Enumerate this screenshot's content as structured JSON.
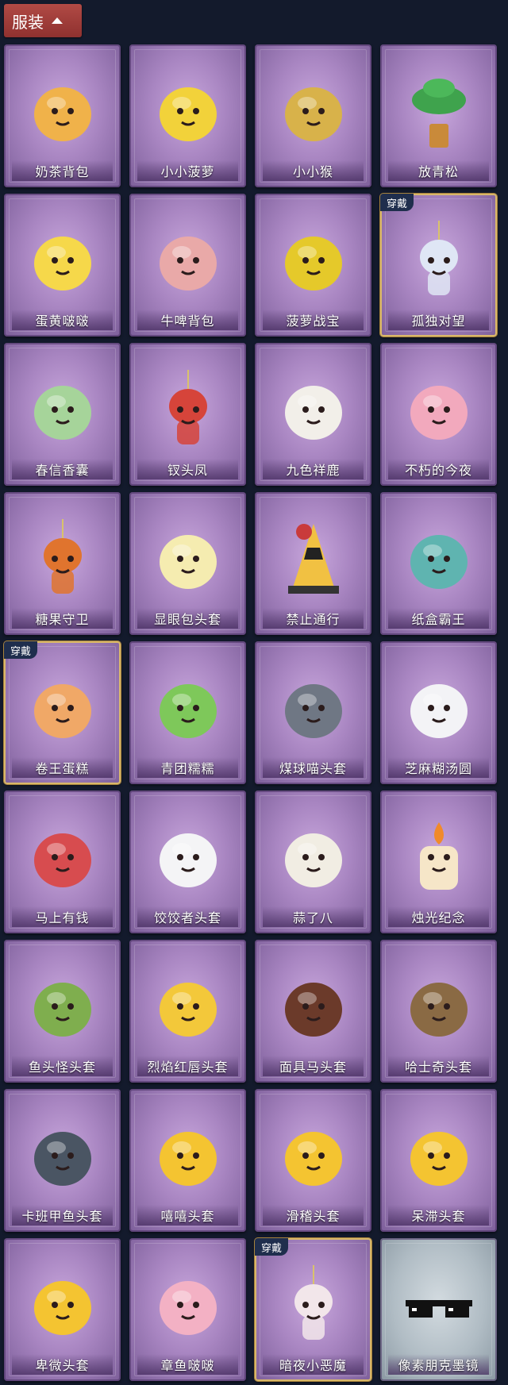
{
  "header": {
    "title": "服装"
  },
  "badge_text": "穿戴",
  "items": [
    {
      "label": "奶茶背包",
      "icon": "milk-tea-backpack-icon",
      "color": "#f0b24a",
      "equipped": false
    },
    {
      "label": "小小菠萝",
      "icon": "pineapple-icon",
      "color": "#f2d23a",
      "equipped": false
    },
    {
      "label": "小小猴",
      "icon": "monkey-icon",
      "color": "#d8b24a",
      "equipped": false
    },
    {
      "label": "放青松",
      "icon": "pine-tree-icon",
      "color": "#3fa34d",
      "equipped": false
    },
    {
      "label": "蛋黄啵啵",
      "icon": "chick-icon",
      "color": "#f6d84a",
      "equipped": false
    },
    {
      "label": "牛啤背包",
      "icon": "cow-beer-icon",
      "color": "#e9a9a8",
      "equipped": false
    },
    {
      "label": "菠萝战宝",
      "icon": "pineapple-robot-icon",
      "color": "#e5c92a",
      "equipped": false
    },
    {
      "label": "孤独对望",
      "icon": "doll-pendant-icon",
      "color": "#dfe6f5",
      "equipped": true
    },
    {
      "label": "春信香囊",
      "icon": "sachet-icon",
      "color": "#a6d49a",
      "equipped": false
    },
    {
      "label": "钗头凤",
      "icon": "phoenix-hairpin-icon",
      "color": "#d6443a",
      "equipped": false
    },
    {
      "label": "九色祥鹿",
      "icon": "deer-icon",
      "color": "#f2efe9",
      "equipped": false
    },
    {
      "label": "不朽的今夜",
      "icon": "pink-cat-bowl-icon",
      "color": "#f2a9bd",
      "equipped": false
    },
    {
      "label": "糖果守卫",
      "icon": "pumpkin-scarecrow-icon",
      "color": "#e0742e",
      "equipped": false
    },
    {
      "label": "显眼包头套",
      "icon": "light-bulb-icon",
      "color": "#f5ecb0",
      "equipped": false
    },
    {
      "label": "禁止通行",
      "icon": "traffic-cone-icon",
      "color": "#f1c142",
      "equipped": false
    },
    {
      "label": "纸盒霸王",
      "icon": "box-dinosaur-icon",
      "color": "#5fb4b0",
      "equipped": false
    },
    {
      "label": "卷王蛋糕",
      "icon": "roll-cake-icon",
      "color": "#f0a867",
      "equipped": true
    },
    {
      "label": "青团糯糯",
      "icon": "green-dumpling-icon",
      "color": "#7ec85a",
      "equipped": false
    },
    {
      "label": "煤球喵头套",
      "icon": "grey-cat-icon",
      "color": "#6f7784",
      "equipped": false
    },
    {
      "label": "芝麻糊汤圆",
      "icon": "rice-ball-icon",
      "color": "#f3f3f6",
      "equipped": false
    },
    {
      "label": "马上有钱",
      "icon": "red-horse-icon",
      "color": "#d74c4f",
      "equipped": false
    },
    {
      "label": "饺饺者头套",
      "icon": "dumpling-icon",
      "color": "#f4f4f6",
      "equipped": false
    },
    {
      "label": "蒜了八",
      "icon": "garlic-icon",
      "color": "#f1ede3",
      "equipped": false
    },
    {
      "label": "烛光纪念",
      "icon": "candle-icon",
      "color": "#f6e6c8",
      "equipped": false
    },
    {
      "label": "鱼头怪头套",
      "icon": "fish-head-icon",
      "color": "#7fae4e",
      "equipped": false
    },
    {
      "label": "烈焰红唇头套",
      "icon": "pikachu-lips-icon",
      "color": "#f3c83a",
      "equipped": false
    },
    {
      "label": "面具马头套",
      "icon": "horse-mask-icon",
      "color": "#6b3a2a",
      "equipped": false
    },
    {
      "label": "哈士奇头套",
      "icon": "husky-icon",
      "color": "#8a6a44",
      "equipped": false
    },
    {
      "label": "卡班甲鱼头套",
      "icon": "turtle-icon",
      "color": "#4a5563",
      "equipped": false
    },
    {
      "label": "嘻嘻头套",
      "icon": "grin-emoji-icon",
      "color": "#f4c431",
      "equipped": false
    },
    {
      "label": "滑稽头套",
      "icon": "smirk-emoji-icon",
      "color": "#f4c431",
      "equipped": false
    },
    {
      "label": "呆滞头套",
      "icon": "dazed-emoji-icon",
      "color": "#f4c431",
      "equipped": false
    },
    {
      "label": "卑微头套",
      "icon": "humble-emoji-icon",
      "color": "#f4c431",
      "equipped": false
    },
    {
      "label": "章鱼啵啵",
      "icon": "octopus-icon",
      "color": "#f3b1c4",
      "equipped": false
    },
    {
      "label": "暗夜小恶魔",
      "icon": "little-devil-icon",
      "color": "#f2e6ea",
      "equipped": true
    },
    {
      "label": "像素朋克墨镜",
      "icon": "pixel-sunglasses-icon",
      "color": "#111111",
      "equipped": false,
      "grey": true
    }
  ]
}
